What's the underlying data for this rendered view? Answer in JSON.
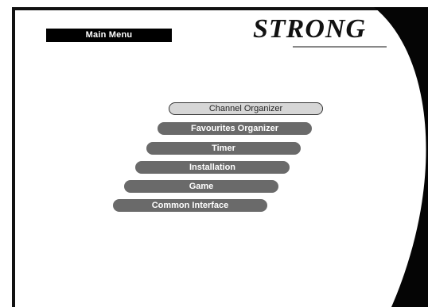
{
  "header": {
    "title": "Main Menu"
  },
  "brand": {
    "logo_text": "STRONG"
  },
  "menu": {
    "items": [
      {
        "label": "Channel Organizer",
        "selected": true
      },
      {
        "label": "Favourites Organizer",
        "selected": false
      },
      {
        "label": "Timer",
        "selected": false
      },
      {
        "label": "Installation",
        "selected": false
      },
      {
        "label": "Game",
        "selected": false
      },
      {
        "label": "Common Interface",
        "selected": false
      }
    ]
  },
  "colors": {
    "background": "#ffffff",
    "frame": "#111111",
    "menu_item": "#6a6a6a",
    "menu_selected": "#d6d6d6"
  }
}
